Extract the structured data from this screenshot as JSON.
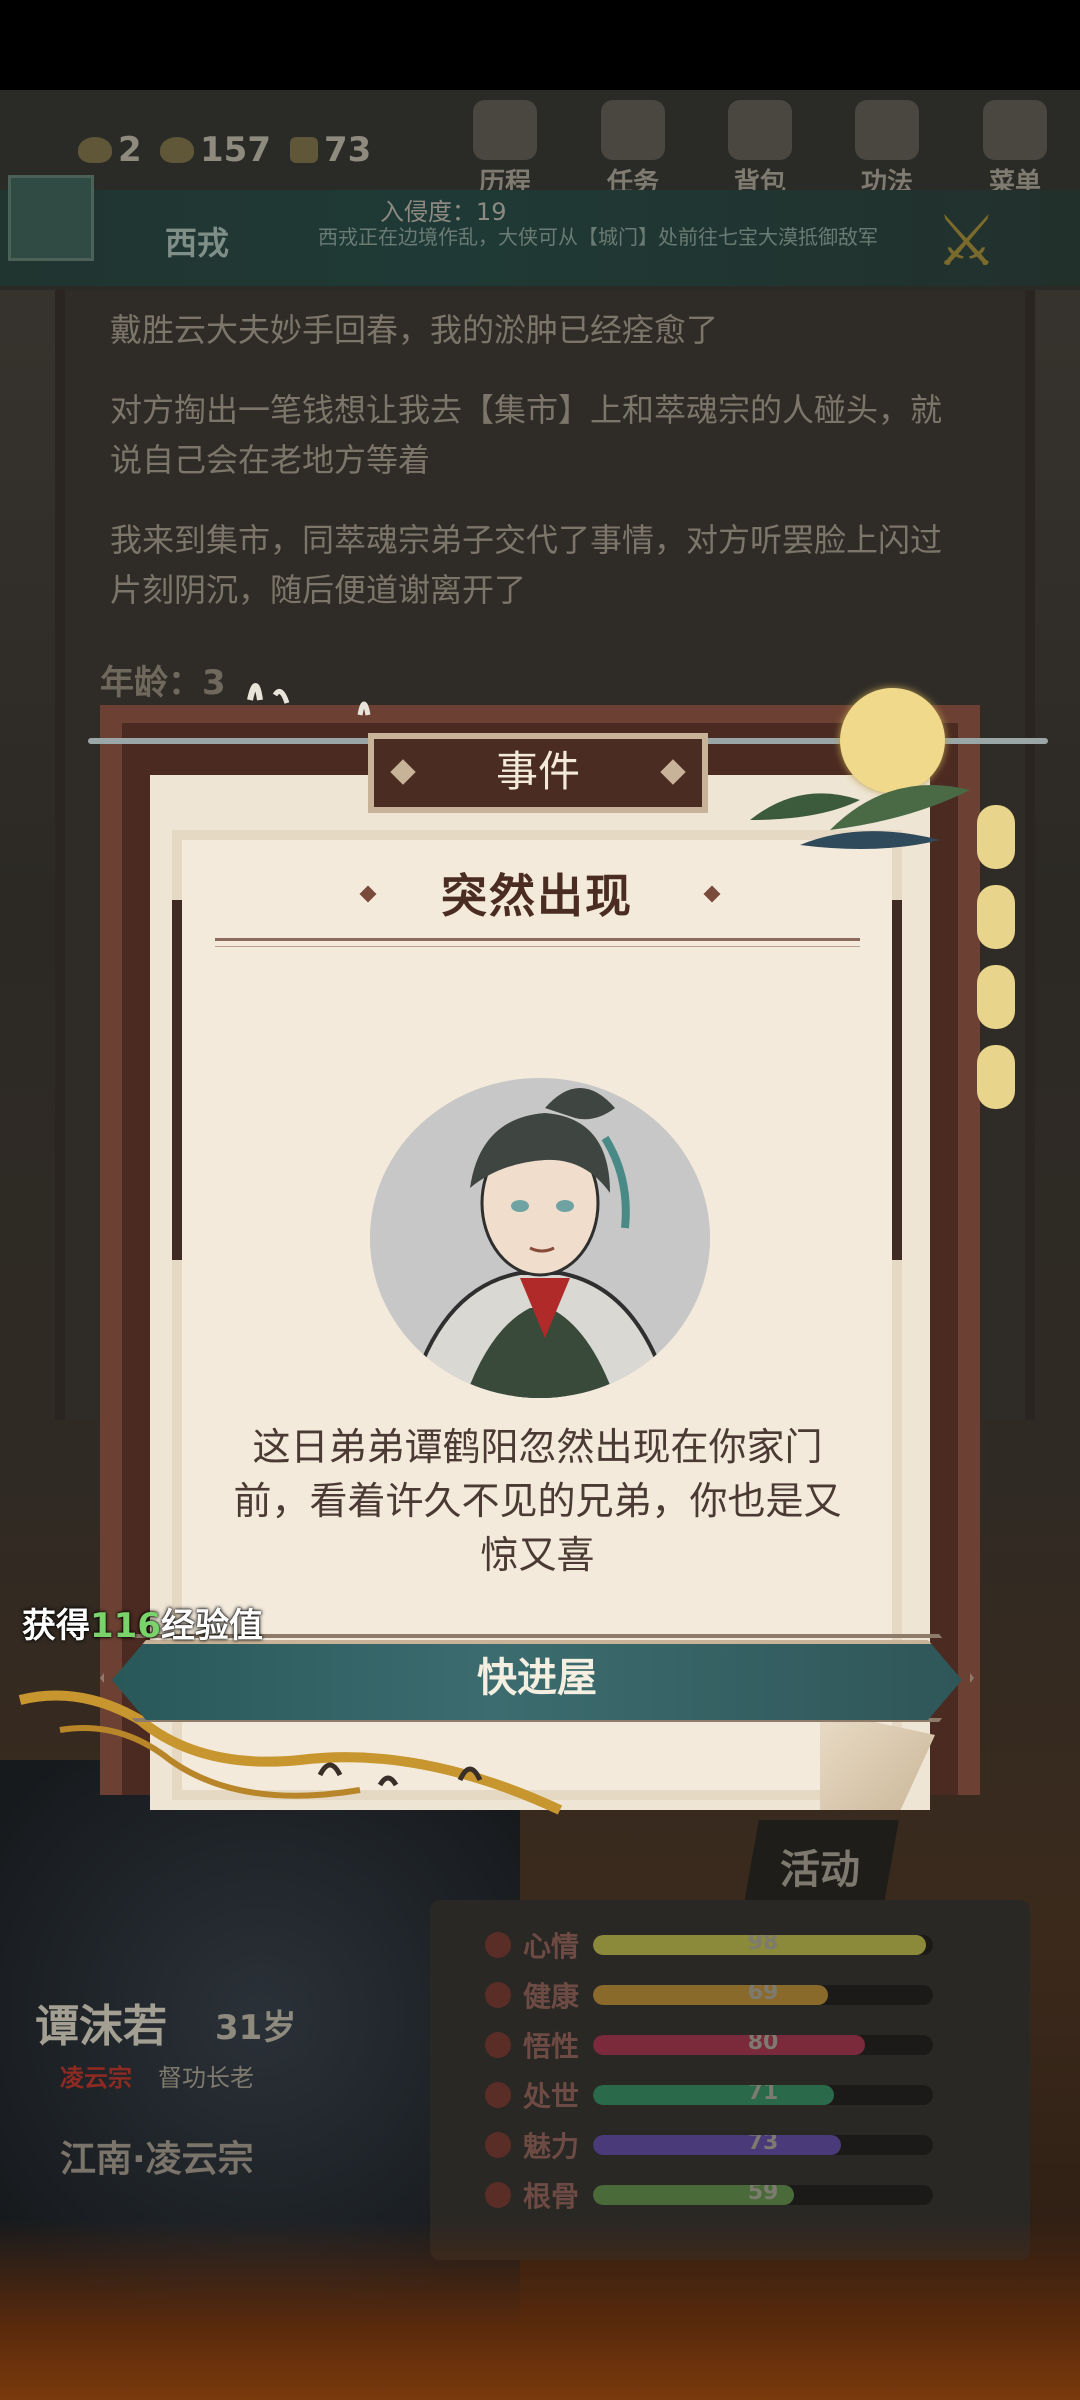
{
  "hud": {
    "res1": "2",
    "res2": "157",
    "res3": "73",
    "nav": [
      {
        "label": "历程",
        "icon": "history-icon"
      },
      {
        "label": "任务",
        "icon": "task-icon"
      },
      {
        "label": "背包",
        "icon": "backpack-icon"
      },
      {
        "label": "功法",
        "icon": "skill-book-icon"
      },
      {
        "label": "菜单",
        "icon": "fan-menu-icon"
      }
    ],
    "progress_label": "入侵度：19",
    "region_name": "西戎",
    "region_desc": "西戎正在边境作乱，大侠可从【城门】处前往七宝大漠抵御敌军"
  },
  "log": {
    "lines": [
      "戴胜云大夫妙手回春，我的淤肿已经痊愈了",
      "对方掏出一笔钱想让我去【集市】上和萃魂宗的人碰头，就说自己会在老地方等着",
      "我来到集市，同萃魂宗弟子交代了事情，对方听罢脸上闪过片刻阴沉，随后便道谢离开了"
    ],
    "age_partial": "年龄：3"
  },
  "character": {
    "name": "谭沫若",
    "age": "31岁",
    "sect": "凌云宗",
    "role": "督功长老",
    "location": "江南·凌云宗"
  },
  "activity_label": "活动",
  "stats": [
    {
      "label": "心情",
      "value": 98,
      "color": "#8a8a3a"
    },
    {
      "label": "健康",
      "value": 69,
      "color": "#8a6a2a"
    },
    {
      "label": "悟性",
      "value": 80,
      "color": "#7a2a3a"
    },
    {
      "label": "处世",
      "value": 71,
      "color": "#2a6a4a"
    },
    {
      "label": "魅力",
      "value": 73,
      "color": "#4a3a7a"
    },
    {
      "label": "根骨",
      "value": 59,
      "color": "#4a6a3a"
    }
  ],
  "modal": {
    "header": "事件",
    "title": "突然出现",
    "text": "这日弟弟谭鹤阳忽然出现在你家门前，看着许久不见的兄弟，你也是又惊又喜",
    "button": "快进屋"
  },
  "exp": {
    "prefix": "获得",
    "amount": "116",
    "suffix": "经验值"
  }
}
